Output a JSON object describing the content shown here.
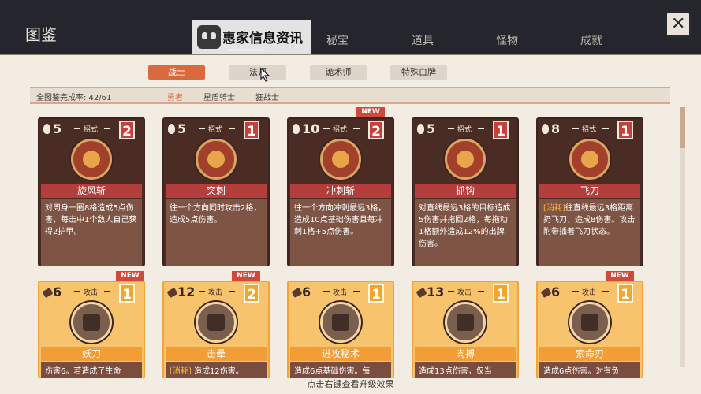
{
  "header": {
    "title": "图鉴",
    "tabs": [
      "秘宝",
      "道具",
      "怪物",
      "成就"
    ],
    "watermark_text": "惠家信息资讯",
    "close_label": "✕"
  },
  "filters": {
    "classes": [
      "战士",
      "法师",
      "诡术师",
      "特殊白牌"
    ],
    "completion": "全图鉴完成率: 42/61",
    "subclasses": [
      "勇者",
      "星盾骑士",
      "狂战士"
    ]
  },
  "new_badge": "NEW",
  "cards_row1": [
    {
      "cost": "5",
      "type": "招式",
      "level": "2",
      "name": "旋风斩",
      "desc": "对周身一圈8格造成5点伤害，每击中1个敌人自己获得2护甲。"
    },
    {
      "cost": "5",
      "type": "招式",
      "level": "1",
      "name": "突刺",
      "desc": "往一个方向同时攻击2格，造成5点伤害。"
    },
    {
      "cost": "10",
      "type": "招式",
      "level": "2",
      "name": "冲刺斩",
      "desc": "往一个方向冲刺最远3格，造成10点基础伤害且每冲刺1格+5点伤害。"
    },
    {
      "cost": "5",
      "type": "招式",
      "level": "1",
      "name": "抓钩",
      "desc": "对直线最远3格的目标造成5伤害并拖回2格，每拖动1格额外造成12%的出牌伤害。"
    },
    {
      "cost": "8",
      "type": "招式",
      "level": "1",
      "name": "飞刀",
      "tag": "[消耗]",
      "desc": "往直线最远3格距离扔飞刀，造成8伤害。攻击附带插着飞刀状态。"
    }
  ],
  "cards_row2": [
    {
      "cost": "6",
      "type": "攻击",
      "level": "1",
      "name": "妖刀",
      "desc": "伤害6。若造成了生命"
    },
    {
      "cost": "12",
      "type": "攻击",
      "level": "2",
      "name": "击晕",
      "tag": "[消耗]",
      "desc": "造成12伤害。"
    },
    {
      "cost": "6",
      "type": "攻击",
      "level": "1",
      "name": "进攻秘术",
      "desc": "造成6点基础伤害。每"
    },
    {
      "cost": "13",
      "type": "攻击",
      "level": "1",
      "name": "肉搏",
      "desc": "造成13点伤害，仅当"
    },
    {
      "cost": "6",
      "type": "攻击",
      "level": "1",
      "name": "索命刃",
      "desc": "造成6点伤害。对有负"
    }
  ],
  "footer_hint": "点击右键查看升级效果",
  "colors": {
    "accent": "#d86a3d",
    "skill_card": "#4a2c25",
    "attack_card": "#f7c46d",
    "banner_red": "#b43e3b"
  }
}
